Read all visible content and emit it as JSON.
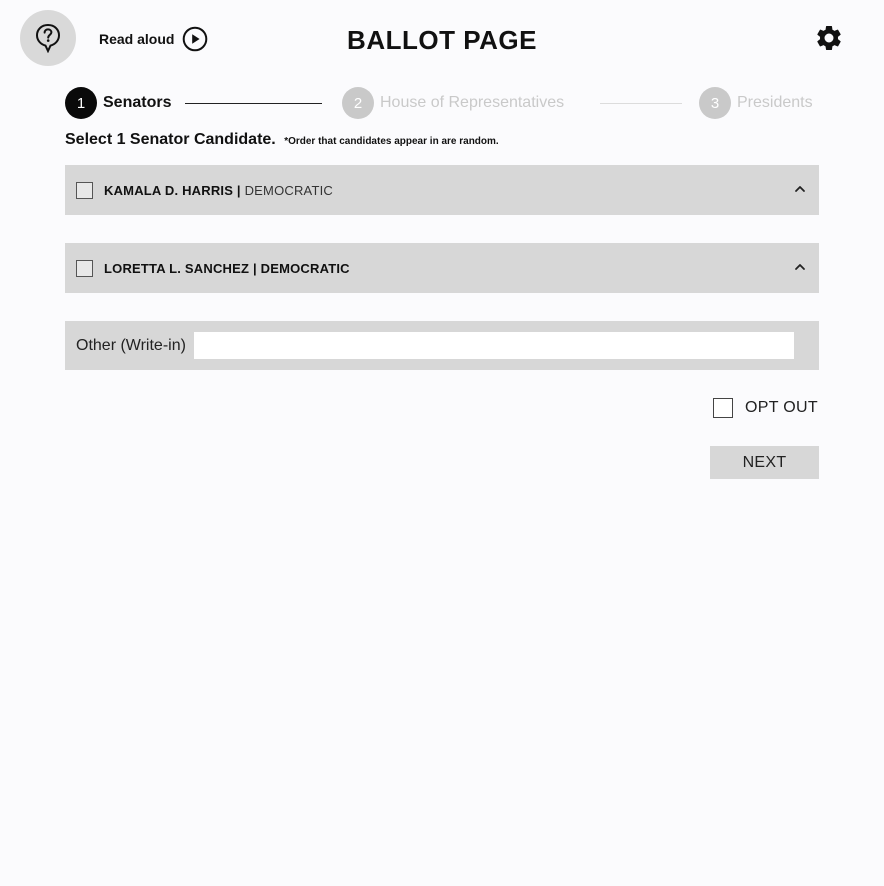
{
  "header": {
    "title": "BALLOT PAGE",
    "help_icon": "question-mark-balloon-icon",
    "read_aloud_label": "Read aloud",
    "read_aloud_icon": "play-circle-icon",
    "settings_icon": "gear-icon"
  },
  "stepper": {
    "steps": [
      {
        "number": "1",
        "label": "Senators",
        "state": "active"
      },
      {
        "number": "2",
        "label": "House of Representatives",
        "state": "inactive"
      },
      {
        "number": "3",
        "label": "Presidents",
        "state": "inactive"
      }
    ]
  },
  "instruction": {
    "main": "Select 1 Senator Candidate.",
    "note": "*Order that candidates appear in are random."
  },
  "candidates": [
    {
      "name": "KAMALA D. HARRIS",
      "separator": "|",
      "party": "DEMOCRATIC",
      "checked": false,
      "expand_icon": "chevron-up-icon"
    },
    {
      "name": "LORETTA L. SANCHEZ",
      "separator": "|",
      "party": "DEMOCRATIC",
      "checked": false,
      "expand_icon": "chevron-up-icon"
    }
  ],
  "writein": {
    "label": "Other (Write-in)",
    "value": ""
  },
  "optout": {
    "label": "OPT OUT",
    "checked": false
  },
  "next_button": {
    "label": "NEXT"
  },
  "colors": {
    "background": "#fbfbfd",
    "panel": "#d7d7d7",
    "active_step": "#0a0a0a",
    "inactive_step": "#c9c9c9"
  }
}
